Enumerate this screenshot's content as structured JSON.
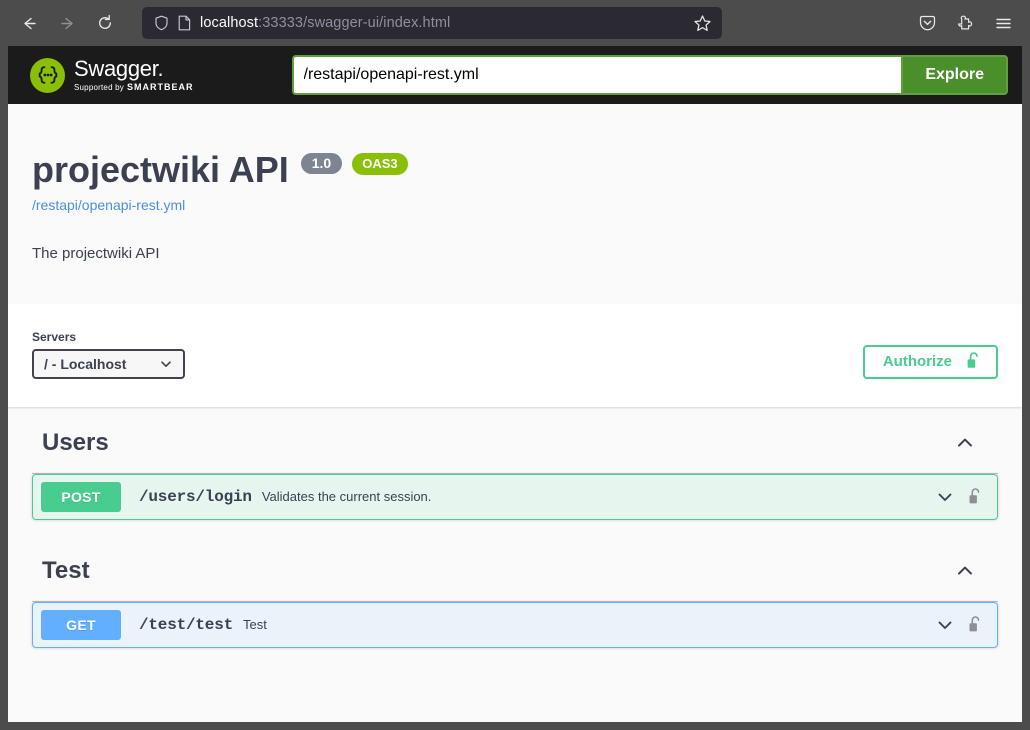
{
  "browser": {
    "back_icon": "back-arrow-icon",
    "forward_icon": "forward-arrow-icon",
    "reload_icon": "reload-icon",
    "shield_icon": "shield-icon",
    "page_icon": "page-document-icon",
    "url_host": "localhost",
    "url_rest": ":33333/swagger-ui/index.html",
    "bookmark_icon": "star-icon",
    "pocket_icon": "save-to-pocket-icon",
    "extensions_icon": "extensions-puzzle-icon",
    "menu_icon": "hamburger-menu-icon"
  },
  "topbar": {
    "logo_text": "Swagger",
    "logo_dot": ".",
    "logo_supported_by": "Supported by",
    "logo_brand": "SMARTBEAR",
    "url_value": "/restapi/openapi-rest.yml",
    "url_placeholder": "",
    "explore_label": "Explore"
  },
  "info": {
    "title": "projectwiki API",
    "version_badge": "1.0",
    "oas_badge": "OAS3",
    "spec_link": "/restapi/openapi-rest.yml",
    "description": "The projectwiki API"
  },
  "servers": {
    "label": "Servers",
    "selected": "/ - Localhost",
    "options": [
      "/ - Localhost"
    ],
    "chevron_icon": "chevron-down-icon"
  },
  "authorize": {
    "label": "Authorize",
    "lock_icon": "unlocked-padlock-icon"
  },
  "colors": {
    "swagger_green": "#89bf04",
    "explore_green": "#4a8f29",
    "post_green": "#49cc90",
    "get_blue": "#61affe",
    "title_slate": "#3b4151",
    "link_blue": "#4990e2",
    "version_gray": "#7d8492"
  },
  "tags": [
    {
      "name": "Users",
      "chevron_icon": "chevron-up-icon",
      "operations": [
        {
          "method": "POST",
          "path": "/users/login",
          "summary": "Validates the current session.",
          "chevron_icon": "chevron-down-icon",
          "lock_icon": "unlocked-padlock-icon",
          "style": "post"
        }
      ]
    },
    {
      "name": "Test",
      "chevron_icon": "chevron-up-icon",
      "operations": [
        {
          "method": "GET",
          "path": "/test/test",
          "summary": "Test",
          "chevron_icon": "chevron-down-icon",
          "lock_icon": "unlocked-padlock-icon",
          "style": "get"
        }
      ]
    }
  ]
}
